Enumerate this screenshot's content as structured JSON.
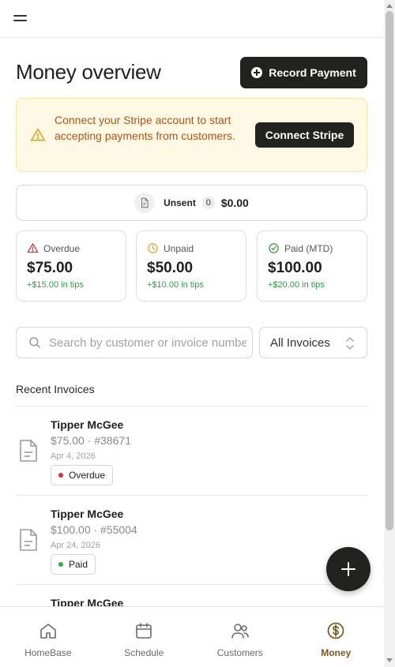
{
  "header": {
    "menu_icon": "menu-icon",
    "title": "Money overview",
    "record_payment_label": "Record Payment"
  },
  "stripe_banner": {
    "message": "Connect your Stripe account to start accepting payments from customers.",
    "button_label": "Connect Stripe",
    "icon": "warning-icon",
    "text_color": "#b5541a",
    "bg_color": "#fef9e5"
  },
  "unsent": {
    "label": "Unsent",
    "count": "0",
    "amount": "$0.00"
  },
  "stats": [
    {
      "label": "Overdue",
      "value": "$75.00",
      "tips": "+$15.00 in tips",
      "icon": "alert-triangle-icon",
      "color": "#e03131"
    },
    {
      "label": "Unpaid",
      "value": "$50.00",
      "tips": "+$10.00 in tips",
      "icon": "clock-icon",
      "color": "#f0a020"
    },
    {
      "label": "Paid (MTD)",
      "value": "$100.00",
      "tips": "+$20.00 in tips",
      "icon": "check-circle-icon",
      "color": "#2f9e44"
    }
  ],
  "search": {
    "placeholder": "Search by customer or invoice number"
  },
  "filter": {
    "selected": "All Invoices"
  },
  "recent": {
    "title": "Recent Invoices",
    "invoices": [
      {
        "customer": "Tipper McGee",
        "amount": "$75.00",
        "number": "#38671",
        "meta": "$75.00 · #38671",
        "date": "Apr 4, 2026",
        "status": "Overdue",
        "status_color": "#e03131"
      },
      {
        "customer": "Tipper McGee",
        "amount": "$100.00",
        "number": "#55004",
        "meta": "$100.00 · #55004",
        "date": "Apr 24, 2026",
        "status": "Paid",
        "status_color": "#2fb344"
      },
      {
        "customer": "Tipper McGee"
      }
    ]
  },
  "nav": {
    "items": [
      {
        "label": "HomeBase",
        "icon": "home-icon"
      },
      {
        "label": "Schedule",
        "icon": "calendar-icon"
      },
      {
        "label": "Customers",
        "icon": "users-icon"
      },
      {
        "label": "Money",
        "icon": "dollar-circle-icon",
        "active": true
      }
    ],
    "active_color": "#7a5a1e"
  }
}
